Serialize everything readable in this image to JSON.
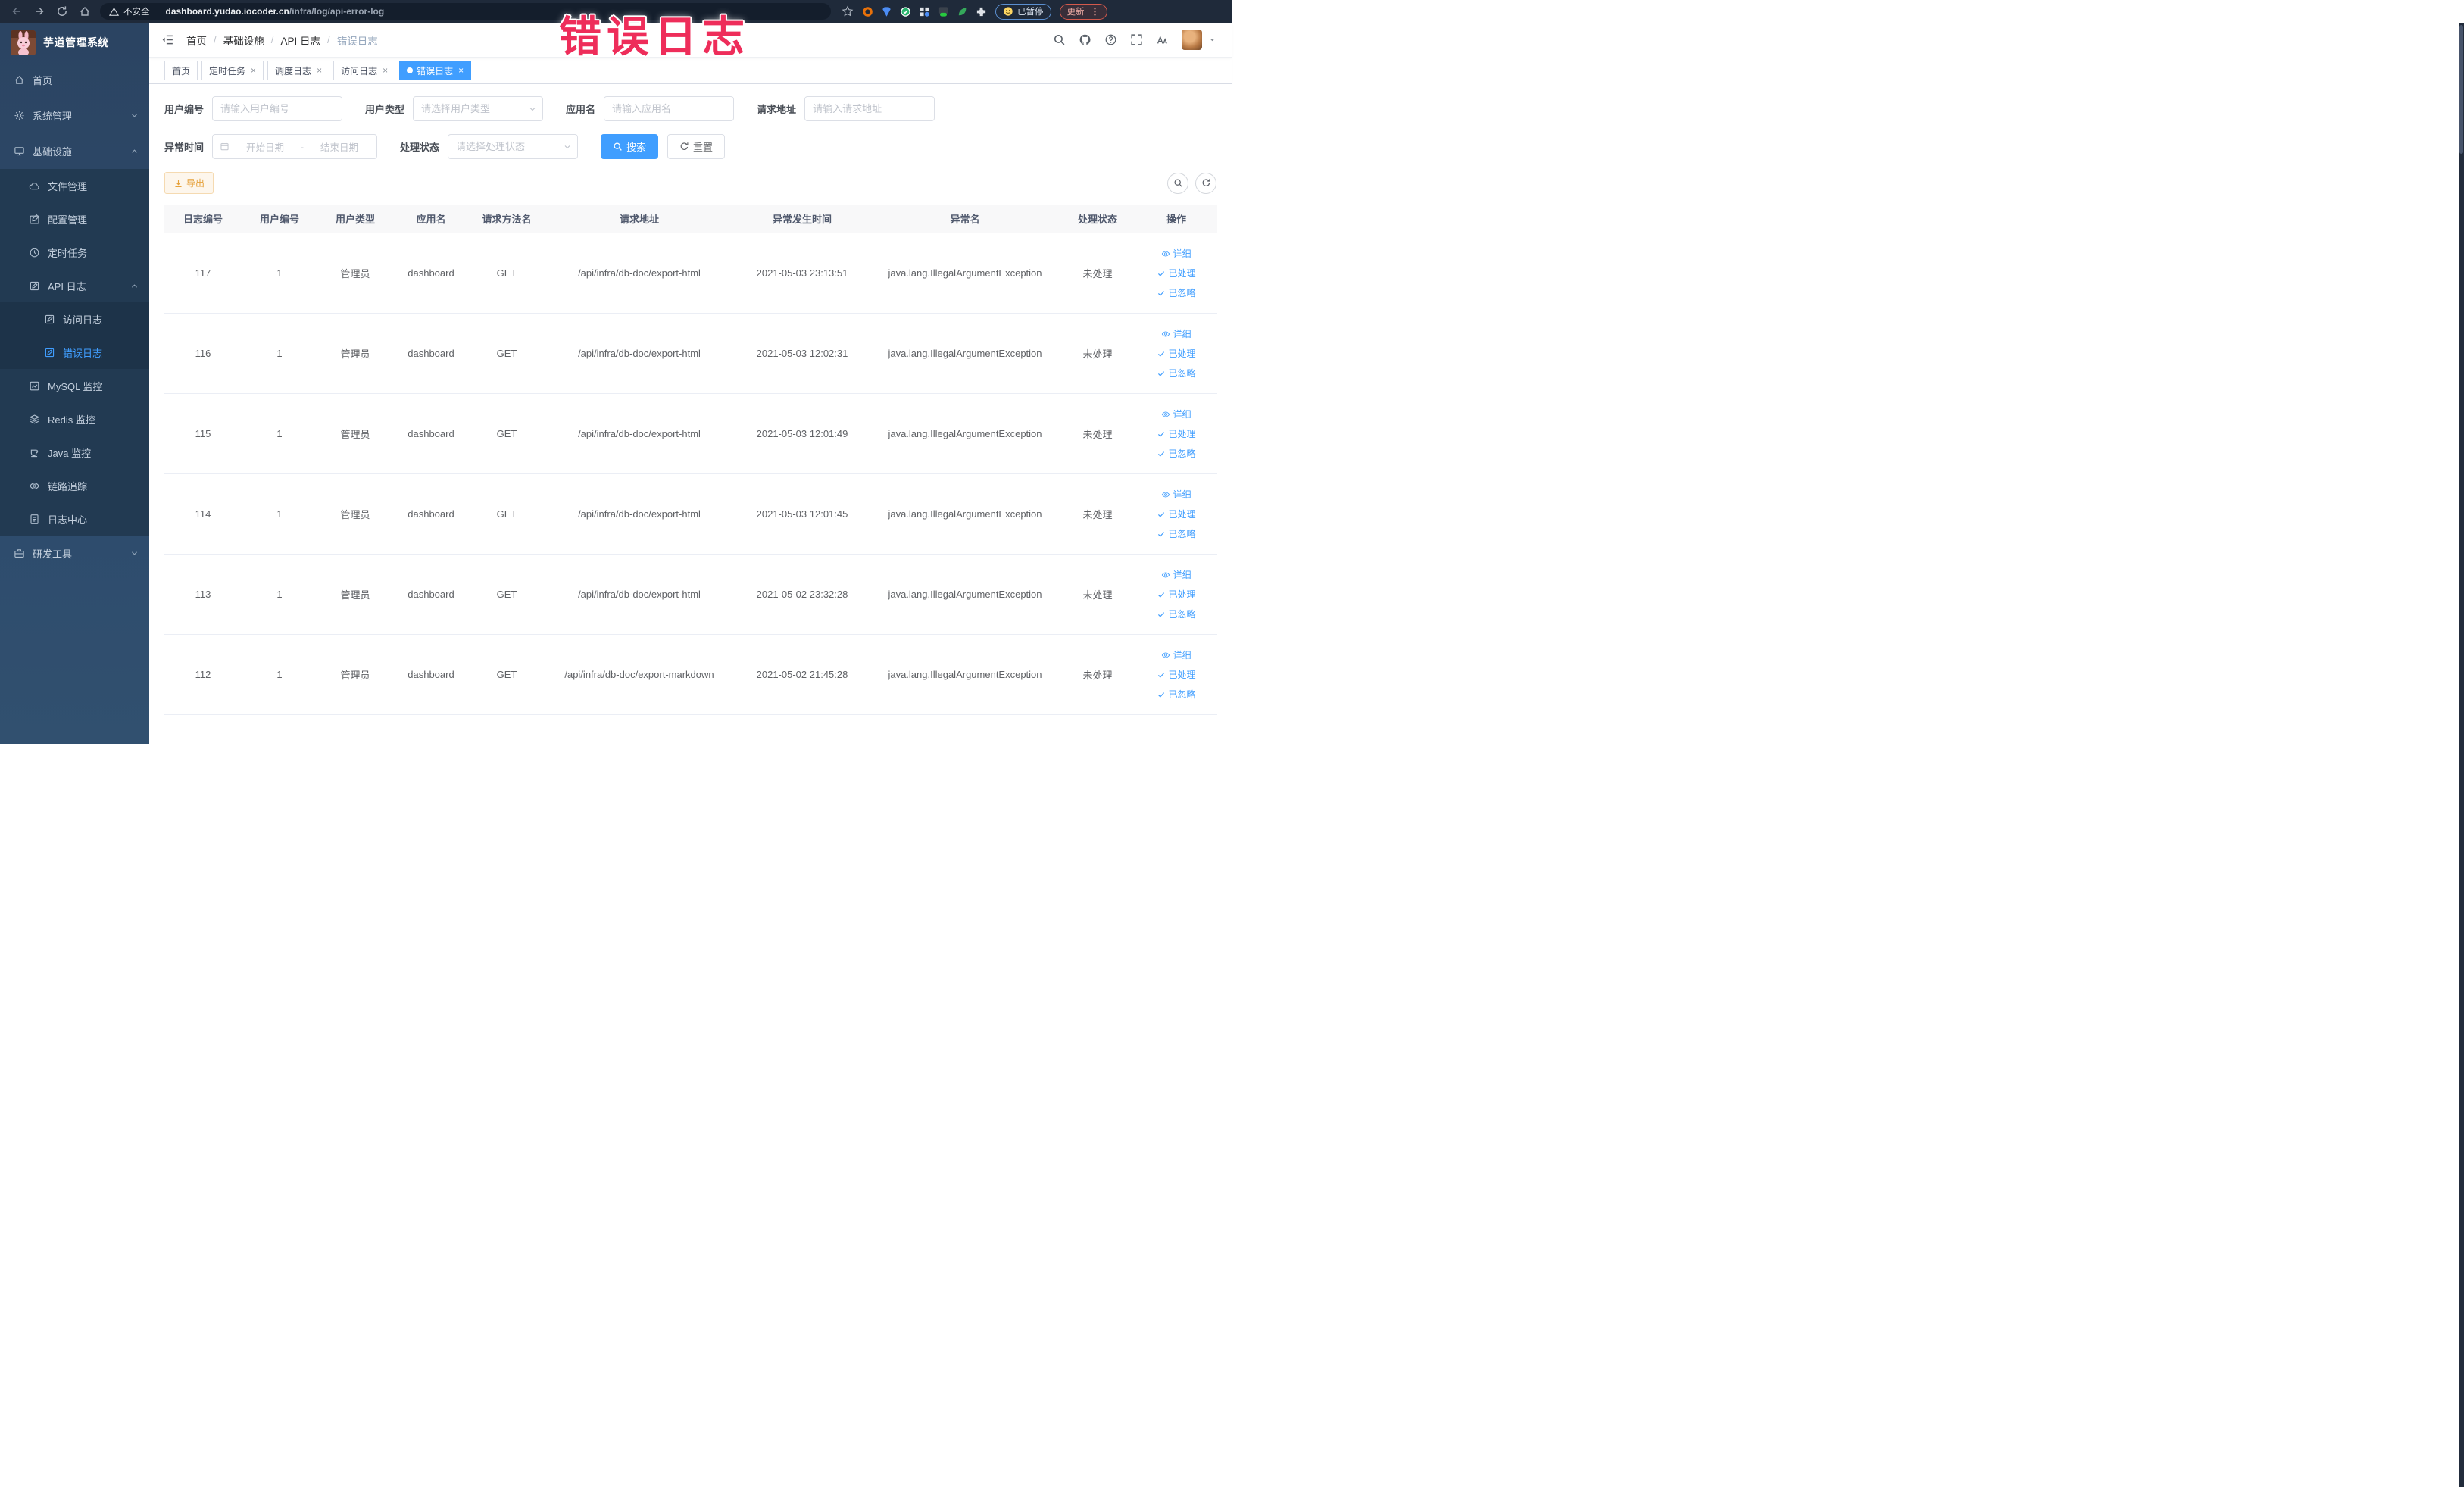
{
  "browser": {
    "security_label": "不安全",
    "url_domain": "dashboard.yudao.iocoder.cn",
    "url_path": "/infra/log/api-error-log",
    "paused_label": "已暂停",
    "update_label": "更新",
    "extension_icons": [
      "orange-ring-ext",
      "blue-shield-ext",
      "green-check-ext",
      "grid-ext",
      "on-badge-ext",
      "green-leaf-ext",
      "puzzle-ext"
    ]
  },
  "watermark_text": "错误日志",
  "sidebar": {
    "title": "芋道管理系统",
    "logo_icon": "rabbit-logo",
    "menu": [
      {
        "label": "首页",
        "icon": "home",
        "level": 1
      },
      {
        "label": "系统管理",
        "icon": "gear",
        "level": 1,
        "chevron": "down"
      },
      {
        "label": "基础设施",
        "icon": "monitor",
        "level": 1,
        "chevron": "up"
      },
      {
        "label": "文件管理",
        "icon": "cloud",
        "level": 2
      },
      {
        "label": "配置管理",
        "icon": "edit",
        "level": 2
      },
      {
        "label": "定时任务",
        "icon": "clock",
        "level": 2
      },
      {
        "label": "API 日志",
        "icon": "doc-edit",
        "level": 2,
        "chevron": "up"
      },
      {
        "label": "访问日志",
        "icon": "doc-edit",
        "level": 3
      },
      {
        "label": "错误日志",
        "icon": "doc-edit",
        "level": 3,
        "active": true
      },
      {
        "label": "MySQL 监控",
        "icon": "chart",
        "level": 2
      },
      {
        "label": "Redis 监控",
        "icon": "layers",
        "level": 2
      },
      {
        "label": "Java 监控",
        "icon": "cup",
        "level": 2
      },
      {
        "label": "链路追踪",
        "icon": "eye",
        "level": 2
      },
      {
        "label": "日志中心",
        "icon": "doc",
        "level": 2
      },
      {
        "label": "研发工具",
        "icon": "toolbox",
        "level": 1,
        "chevron": "down"
      }
    ]
  },
  "header": {
    "breadcrumb": [
      "首页",
      "基础设施",
      "API 日志",
      "错误日志"
    ],
    "separator": "/",
    "right_icons": [
      "search-icon",
      "github-icon",
      "question-icon",
      "fullscreen-icon",
      "font-size-icon",
      "avatar",
      "caret-down-icon"
    ]
  },
  "tags": [
    {
      "label": "首页",
      "closable": false,
      "active": false
    },
    {
      "label": "定时任务",
      "closable": true,
      "active": false
    },
    {
      "label": "调度日志",
      "closable": true,
      "active": false
    },
    {
      "label": "访问日志",
      "closable": true,
      "active": false
    },
    {
      "label": "错误日志",
      "closable": true,
      "active": true
    }
  ],
  "tag_close_glyph": "×",
  "filters": {
    "user_id": {
      "label": "用户编号",
      "placeholder": "请输入用户编号"
    },
    "user_type": {
      "label": "用户类型",
      "placeholder": "请选择用户类型"
    },
    "app_name": {
      "label": "应用名",
      "placeholder": "请输入应用名"
    },
    "request_url": {
      "label": "请求地址",
      "placeholder": "请输入请求地址"
    },
    "exception_time": {
      "label": "异常时间",
      "start_placeholder": "开始日期",
      "separator": "-",
      "end_placeholder": "结束日期"
    },
    "process_status": {
      "label": "处理状态",
      "placeholder": "请选择处理状态"
    },
    "search_label": "搜索",
    "reset_label": "重置"
  },
  "toolbar": {
    "export_label": "导出",
    "right_buttons": [
      "search-toggle",
      "refresh"
    ]
  },
  "table": {
    "headers": [
      "日志编号",
      "用户编号",
      "用户类型",
      "应用名",
      "请求方法名",
      "请求地址",
      "异常发生时间",
      "异常名",
      "处理状态",
      "操作"
    ],
    "row_actions": [
      "详细",
      "已处理",
      "已忽略"
    ],
    "row_action_icons": [
      "eye-icon",
      "check-icon",
      "check-icon"
    ],
    "rows": [
      {
        "log_id": "117",
        "user_id": "1",
        "user_type": "管理员",
        "app_name": "dashboard",
        "method": "GET",
        "request_url": "/api/infra/db-doc/export-html",
        "time": "2021-05-03 23:13:51",
        "exception": "java.lang.IllegalArgumentException",
        "status": "未处理"
      },
      {
        "log_id": "116",
        "user_id": "1",
        "user_type": "管理员",
        "app_name": "dashboard",
        "method": "GET",
        "request_url": "/api/infra/db-doc/export-html",
        "time": "2021-05-03 12:02:31",
        "exception": "java.lang.IllegalArgumentException",
        "status": "未处理"
      },
      {
        "log_id": "115",
        "user_id": "1",
        "user_type": "管理员",
        "app_name": "dashboard",
        "method": "GET",
        "request_url": "/api/infra/db-doc/export-html",
        "time": "2021-05-03 12:01:49",
        "exception": "java.lang.IllegalArgumentException",
        "status": "未处理"
      },
      {
        "log_id": "114",
        "user_id": "1",
        "user_type": "管理员",
        "app_name": "dashboard",
        "method": "GET",
        "request_url": "/api/infra/db-doc/export-html",
        "time": "2021-05-03 12:01:45",
        "exception": "java.lang.IllegalArgumentException",
        "status": "未处理"
      },
      {
        "log_id": "113",
        "user_id": "1",
        "user_type": "管理员",
        "app_name": "dashboard",
        "method": "GET",
        "request_url": "/api/infra/db-doc/export-html",
        "time": "2021-05-02 23:32:28",
        "exception": "java.lang.IllegalArgumentException",
        "status": "未处理"
      },
      {
        "log_id": "112",
        "user_id": "1",
        "user_type": "管理员",
        "app_name": "dashboard",
        "method": "GET",
        "request_url": "/api/infra/db-doc/export-markdown",
        "time": "2021-05-02 21:45:28",
        "exception": "java.lang.IllegalArgumentException",
        "status": "未处理"
      }
    ]
  },
  "colors": {
    "accent": "#409eff",
    "watermark": "#ee2d5a",
    "export_warning": "#e6a23c",
    "sidebar_bg": "#2e4c6d",
    "sidebar_submenu_bg": "#223a52",
    "chrome_bg": "#1f2a3a"
  }
}
